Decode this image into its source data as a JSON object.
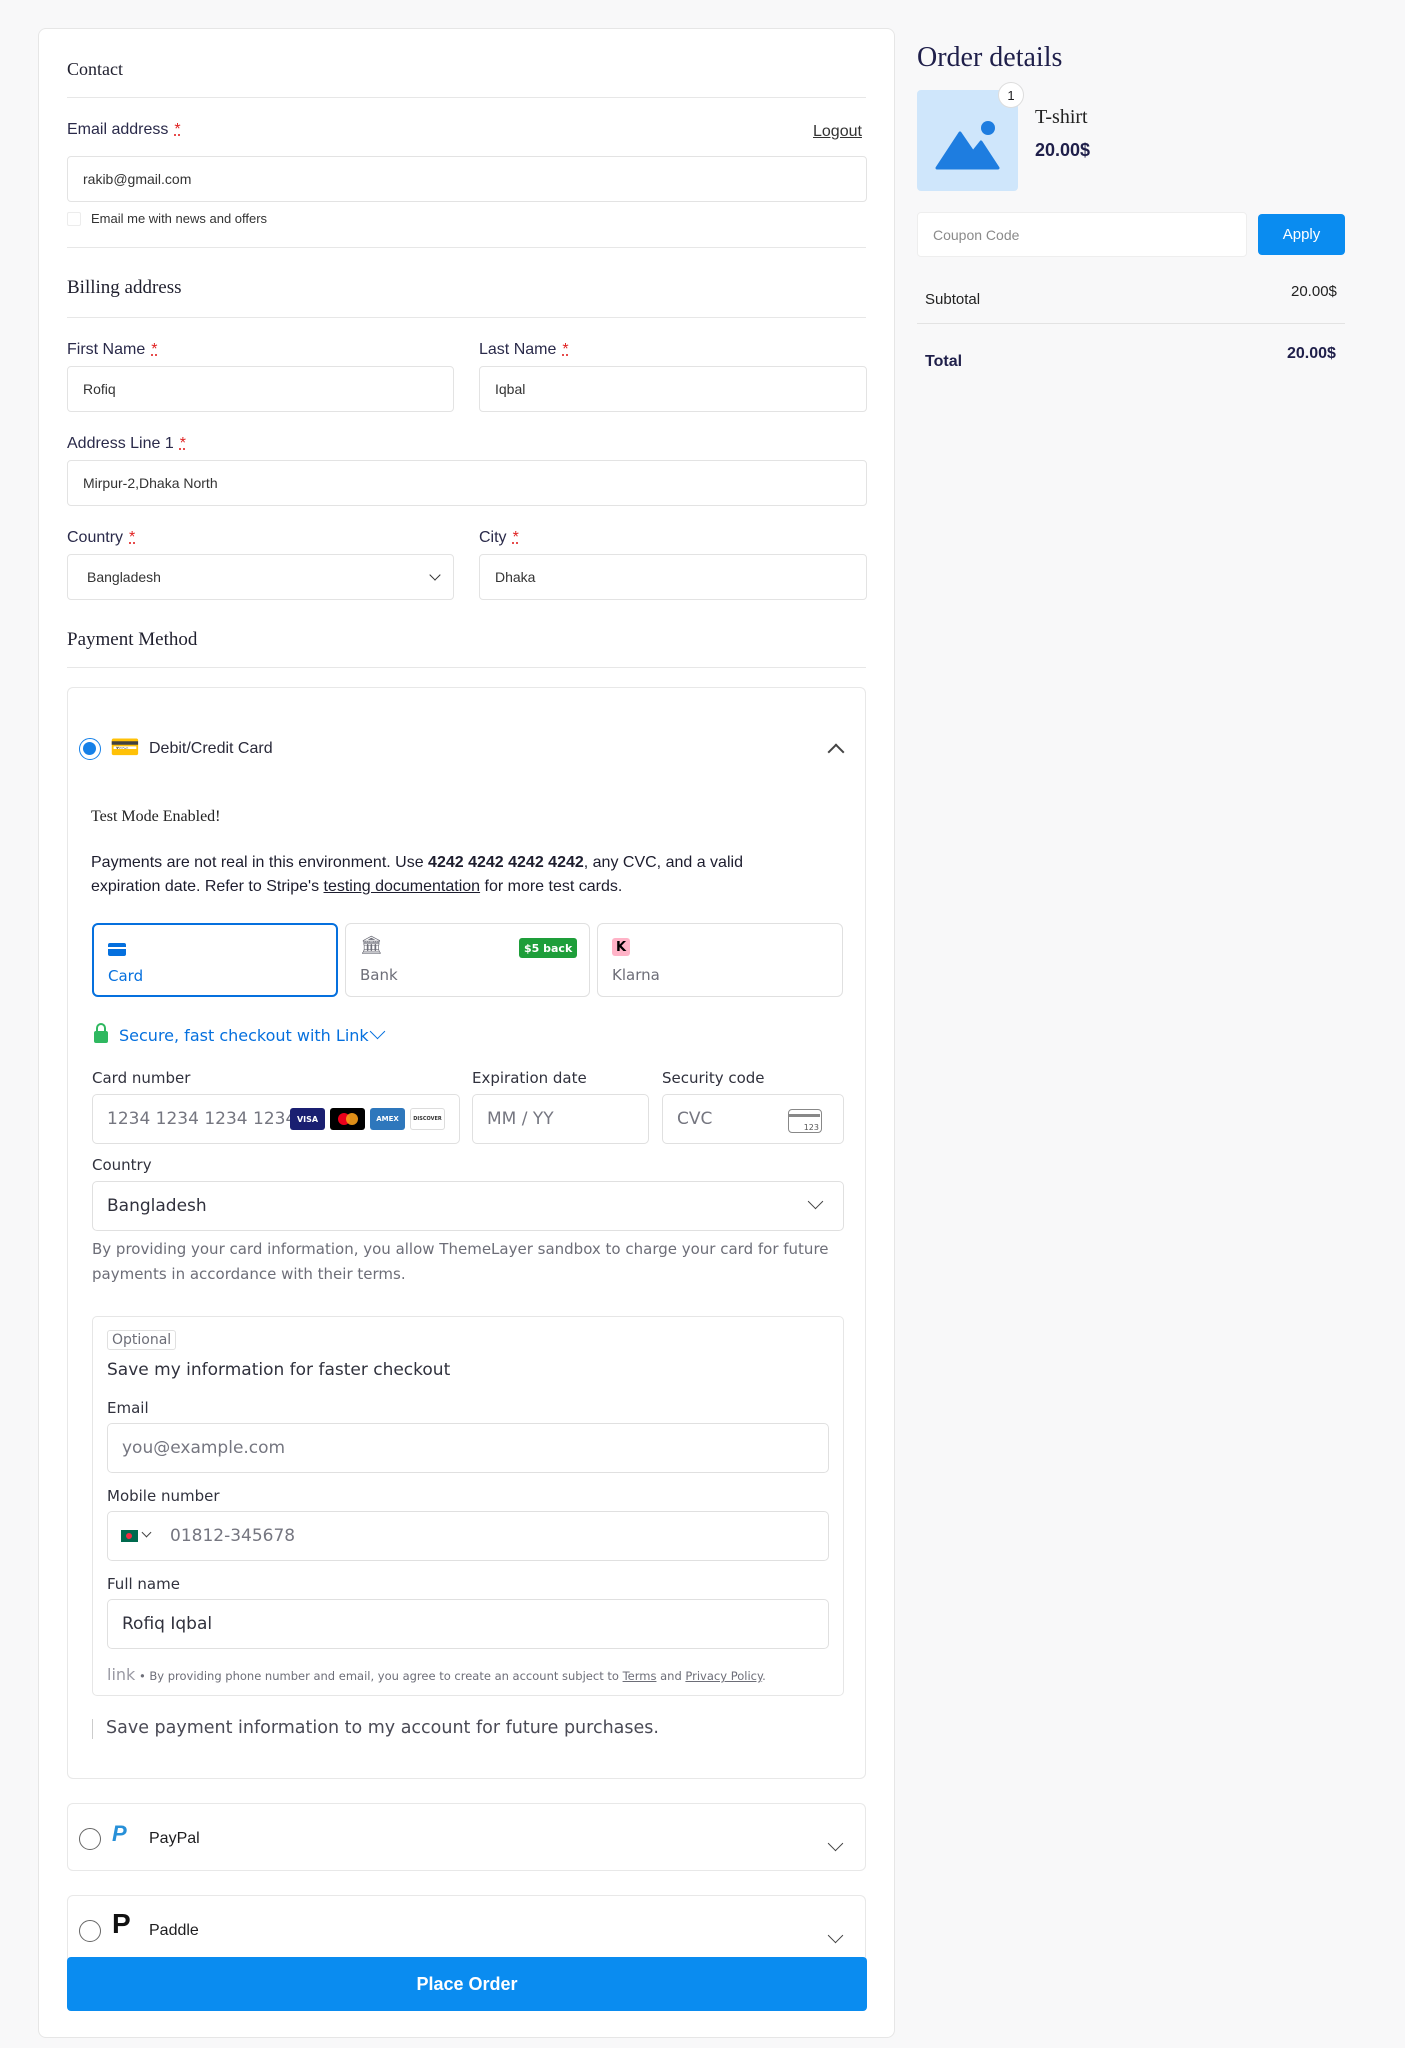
{
  "contact": {
    "title": "Contact",
    "email_label": "Email address",
    "required_mark": "*",
    "logout": "Logout",
    "email_value": "rakib@gmail.com",
    "news_label": "Email me with news and offers"
  },
  "billing": {
    "title": "Billing address",
    "first_name_label": "First Name",
    "first_name_value": "Rofiq",
    "last_name_label": "Last Name",
    "last_name_value": "Iqbal",
    "address_label": "Address Line 1",
    "address_value": "Mirpur-2,Dhaka North",
    "country_label": "Country",
    "country_value": "Bangladesh",
    "city_label": "City",
    "city_value": "Dhaka"
  },
  "payment": {
    "title": "Payment Method",
    "card_method_label": "Debit/Credit Card",
    "test_mode_title": "Test Mode Enabled!",
    "test_text_1": "Payments are not real in this environment. Use ",
    "test_card": "4242 4242 4242 4242",
    "test_text_2": ", any CVC, and a valid",
    "test_text_3": "expiration date. Refer to Stripe's ",
    "test_link": "testing documentation",
    "test_text_4": " for more test cards.",
    "paypal_label": "PayPal",
    "paddle_label": "Paddle",
    "place_order": "Place Order"
  },
  "stripe": {
    "tabs": [
      {
        "label": "Card",
        "icon": "card-icon"
      },
      {
        "label": "Bank",
        "icon": "bank-icon",
        "badge": "$5 back"
      },
      {
        "label": "Klarna",
        "icon": "klarna-icon"
      }
    ],
    "link_text": "Secure, fast checkout with Link",
    "card_number_label": "Card number",
    "card_number_placeholder": "1234 1234 1234 1234",
    "brands": [
      "VISA",
      "",
      "AMEX",
      "DISCOVER"
    ],
    "expiry_label": "Expiration date",
    "expiry_placeholder": "MM / YY",
    "cvc_label": "Security code",
    "cvc_placeholder": "CVC",
    "cvc_icon_text": "123",
    "country_label": "Country",
    "country_value": "Bangladesh",
    "terms_1": "By providing your card information, you allow ThemeLayer sandbox to charge your card for future",
    "terms_2": "payments in accordance with their terms.",
    "optional_badge": "Optional",
    "save_title": "Save my information for faster checkout",
    "email_label": "Email",
    "email_placeholder": "you@example.com",
    "mobile_label": "Mobile number",
    "mobile_value": "01812-345678",
    "fullname_label": "Full name",
    "fullname_value": "Rofiq Iqbal",
    "link_logo": "link",
    "footer_1": " • By providing phone number and email, you agree to create an account subject to ",
    "terms_link": "Terms",
    "footer_and": " and ",
    "privacy_link": "Privacy Policy",
    "footer_end": ".",
    "save_future": "Save payment information to my account for future purchases."
  },
  "order": {
    "title": "Order details",
    "qty": "1",
    "product_name": "T-shirt",
    "product_price": "20.00$",
    "coupon_placeholder": "Coupon Code",
    "apply": "Apply",
    "subtotal_label": "Subtotal",
    "subtotal_value": "20.00$",
    "total_label": "Total",
    "total_value": "20.00$"
  },
  "colors": {
    "accent": "#0a8cf0",
    "stripe_blue": "#0570de",
    "link_green": "#2fb860",
    "badge_green": "#1e9e3a"
  }
}
